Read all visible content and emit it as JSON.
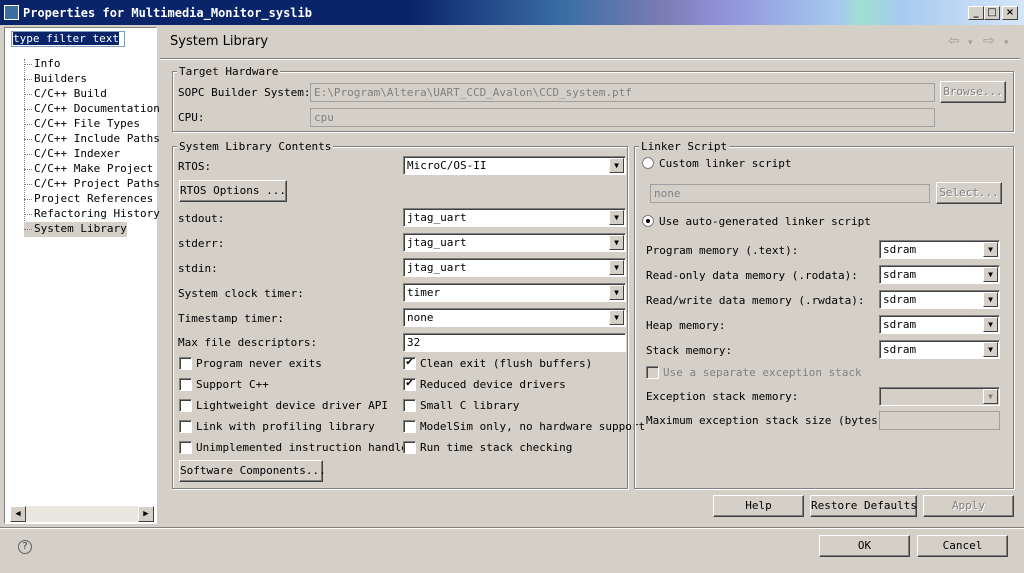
{
  "window": {
    "title": "Properties for Multimedia_Monitor_syslib",
    "minimize": "_",
    "maximize": "□",
    "close": "×"
  },
  "sidebar": {
    "filter_value": "type filter text",
    "items": [
      {
        "label": "Info"
      },
      {
        "label": "Builders"
      },
      {
        "label": "C/C++ Build"
      },
      {
        "label": "C/C++ Documentation"
      },
      {
        "label": "C/C++ File Types"
      },
      {
        "label": "C/C++ Include Paths"
      },
      {
        "label": "C/C++ Indexer"
      },
      {
        "label": "C/C++ Make Project"
      },
      {
        "label": "C/C++ Project Paths"
      },
      {
        "label": "Project References"
      },
      {
        "label": "Refactoring History"
      },
      {
        "label": "System Library",
        "selected": true
      }
    ]
  },
  "header": {
    "title": "System Library"
  },
  "target_hardware": {
    "group_label": "Target Hardware",
    "sopc_label": "SOPC Builder System:",
    "sopc_value": "E:\\Program\\Altera\\UART_CCD_Avalon\\CCD_system.ptf",
    "browse_label": "Browse...",
    "cpu_label": "CPU:",
    "cpu_value": "cpu"
  },
  "contents": {
    "group_label": "System Library Contents",
    "rtos_label": "RTOS:",
    "rtos_value": "MicroC/OS-II",
    "rtos_options_label": "RTOS Options ...",
    "stdout_label": "stdout:",
    "stdout_value": "jtag_uart",
    "stderr_label": "stderr:",
    "stderr_value": "jtag_uart",
    "stdin_label": "stdin:",
    "stdin_value": "jtag_uart",
    "sys_clock_label": "System clock timer:",
    "sys_clock_value": "timer",
    "timestamp_label": "Timestamp timer:",
    "timestamp_value": "none",
    "max_fd_label": "Max file descriptors:",
    "max_fd_value": "32",
    "checkboxes_left": [
      {
        "label": "Program never exits",
        "checked": false
      },
      {
        "label": "Support C++",
        "checked": false
      },
      {
        "label": "Lightweight device driver API",
        "checked": false
      },
      {
        "label": "Link with profiling library",
        "checked": false
      },
      {
        "label": "Unimplemented instruction handler",
        "checked": false
      }
    ],
    "checkboxes_right": [
      {
        "label": "Clean exit (flush buffers)",
        "checked": true
      },
      {
        "label": "Reduced device drivers",
        "checked": true
      },
      {
        "label": "Small C library",
        "checked": false
      },
      {
        "label": "ModelSim only, no hardware support",
        "checked": false
      },
      {
        "label": "Run time stack checking",
        "checked": false
      }
    ],
    "software_components_label": "Software Components..."
  },
  "linker": {
    "group_label": "Linker Script",
    "custom_label": "Custom linker script",
    "custom_value": "none",
    "select_label": "Select...",
    "auto_label": "Use auto-generated linker script",
    "program_mem_label": "Program memory (.text):",
    "program_mem_value": "sdram",
    "rodata_label": "Read-only data memory (.rodata):",
    "rodata_value": "sdram",
    "rwdata_label": "Read/write data memory (.rwdata):",
    "rwdata_value": "sdram",
    "heap_label": "Heap memory:",
    "heap_value": "sdram",
    "stack_label": "Stack memory:",
    "stack_value": "sdram",
    "sep_exc_label": "Use a separate exception stack",
    "exc_mem_label": "Exception stack memory:",
    "exc_max_label": "Maximum exception stack size (bytes):"
  },
  "actions": {
    "help": "Help",
    "restore": "Restore Defaults",
    "apply": "Apply",
    "ok": "OK",
    "cancel": "Cancel"
  },
  "icons": {
    "help_glyph": "?",
    "check_glyph": "✔"
  }
}
